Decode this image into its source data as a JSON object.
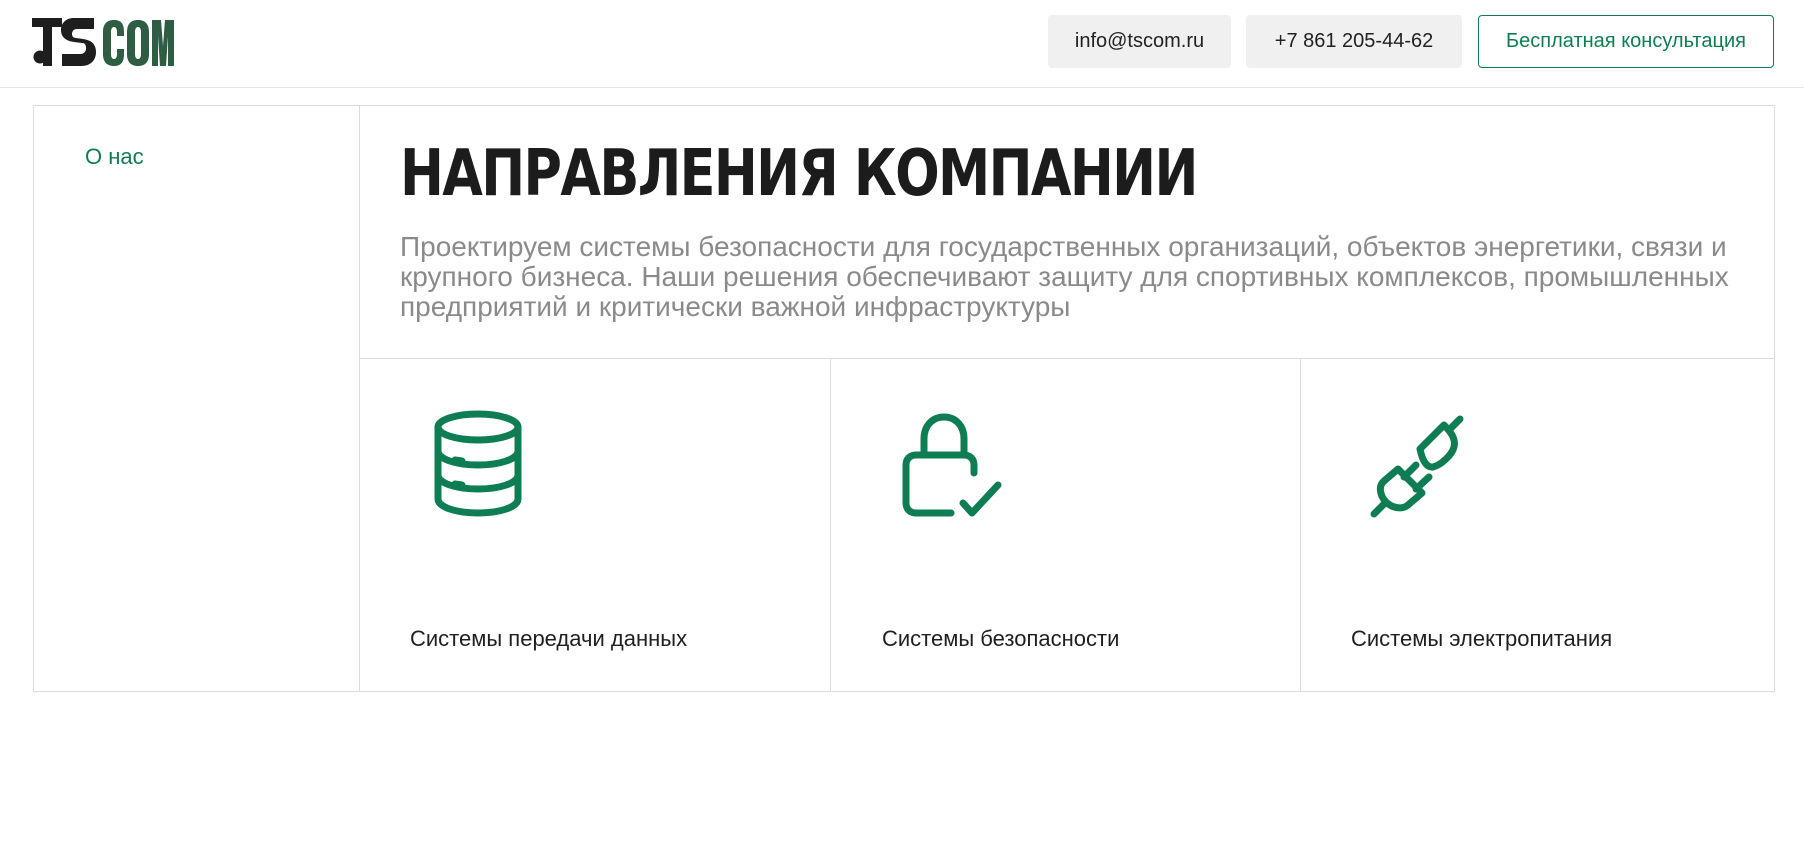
{
  "header": {
    "logo_text": "TSCOM",
    "email_label": "info@tscom.ru",
    "phone_label": "+7 861 205-44-62",
    "consult_label": "Бесплатная консультация"
  },
  "sidebar": {
    "items": [
      {
        "label": "О нас"
      }
    ]
  },
  "main": {
    "title": "НАПРАВЛЕНИЯ КОМПАНИИ",
    "lead": "Проектируем системы безопасности для государственных организаций, объектов энергетики, связи и крупного бизнеса. Наши решения обеспечивают защиту для спортивных комплексов, промышленных предприятий и критически важной инфраструктуры",
    "cards": [
      {
        "label": "Системы передачи данных",
        "icon": "database-icon"
      },
      {
        "label": "Системы безопасности",
        "icon": "lock-check-icon"
      },
      {
        "label": "Системы электропитания",
        "icon": "plug-icon"
      }
    ]
  },
  "colors": {
    "accent": "#0e7d54",
    "logo_dark": "#1e1e1e",
    "logo_green": "#2f5d43",
    "border": "#dcdcdc",
    "button_bg": "#f0f0f0",
    "lead_text": "#8a8a8a"
  }
}
